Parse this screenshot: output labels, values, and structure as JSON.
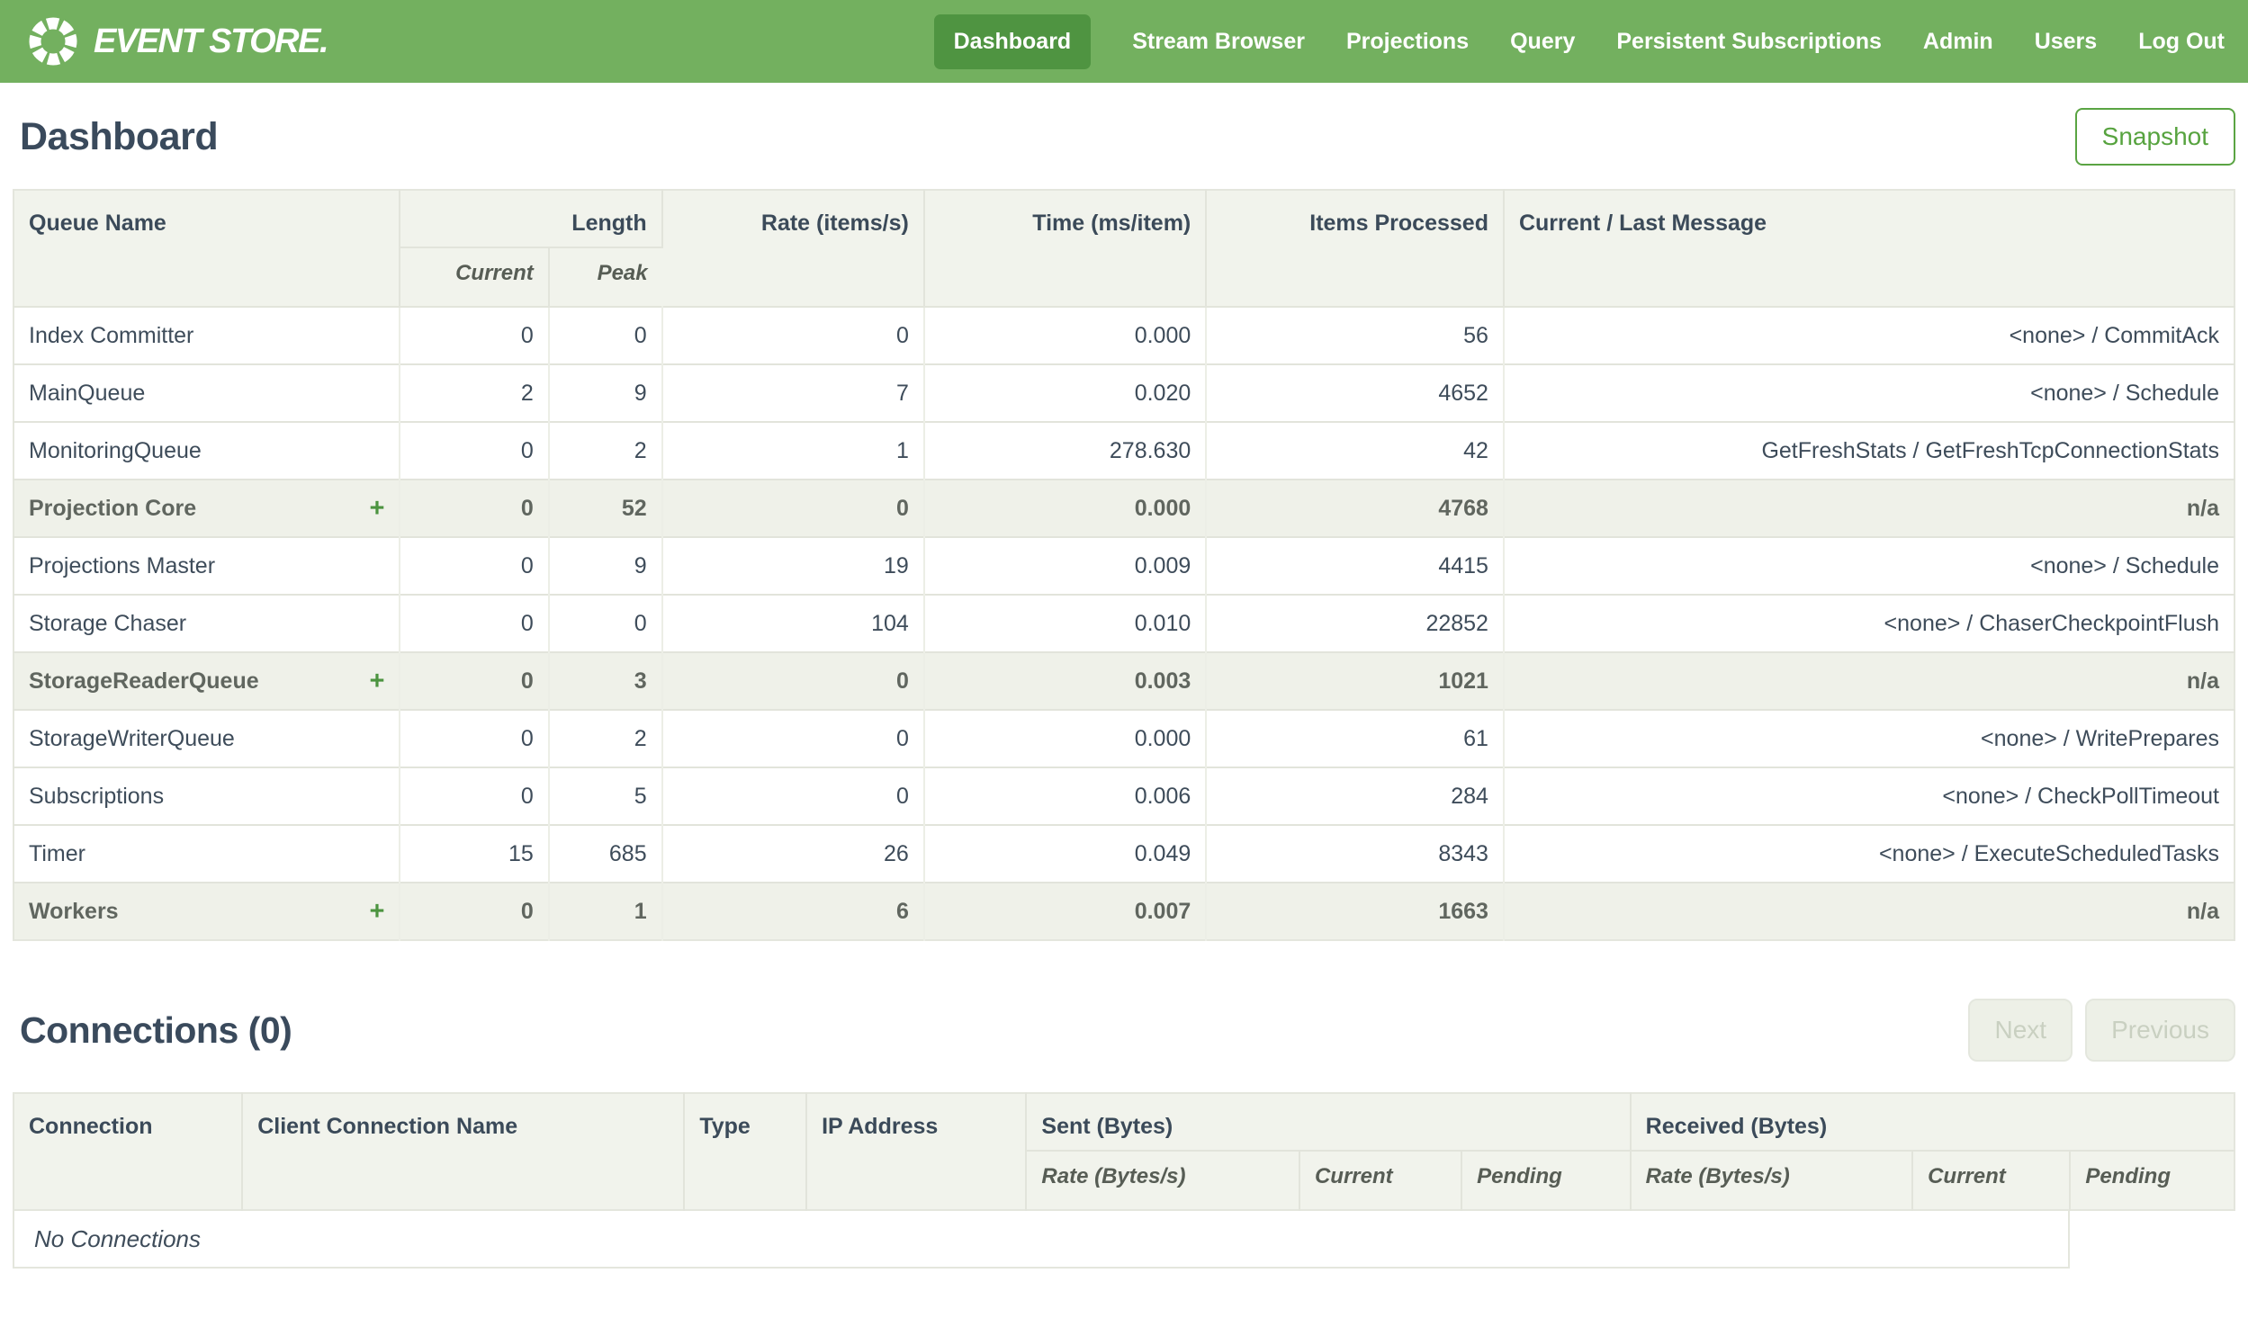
{
  "header": {
    "logo_text": "EVENT STORE.",
    "logo_icon": "segmented-ring-icon",
    "nav": [
      {
        "label": "Dashboard",
        "active": true
      },
      {
        "label": "Stream Browser"
      },
      {
        "label": "Projections"
      },
      {
        "label": "Query"
      },
      {
        "label": "Persistent Subscriptions"
      },
      {
        "label": "Admin"
      },
      {
        "label": "Users"
      },
      {
        "label": "Log Out"
      }
    ]
  },
  "page": {
    "title": "Dashboard",
    "snapshot_button": "Snapshot"
  },
  "queues_table": {
    "headers": {
      "queue_name": "Queue Name",
      "length": "Length",
      "current": "Current",
      "peak": "Peak",
      "rate": "Rate (items/s)",
      "time": "Time (ms/item)",
      "items_processed": "Items Processed",
      "message": "Current / Last Message"
    },
    "expand_glyph": "+",
    "rows": [
      {
        "name": "Index Committer",
        "current": "0",
        "peak": "0",
        "rate": "0",
        "time": "0.000",
        "items": "56",
        "message": "<none> / CommitAck",
        "group": false
      },
      {
        "name": "MainQueue",
        "current": "2",
        "peak": "9",
        "rate": "7",
        "time": "0.020",
        "items": "4652",
        "message": "<none> / Schedule",
        "group": false
      },
      {
        "name": "MonitoringQueue",
        "current": "0",
        "peak": "2",
        "rate": "1",
        "time": "278.630",
        "items": "42",
        "message": "GetFreshStats / GetFreshTcpConnectionStats",
        "group": false
      },
      {
        "name": "Projection Core",
        "current": "0",
        "peak": "52",
        "rate": "0",
        "time": "0.000",
        "items": "4768",
        "message": "n/a",
        "group": true
      },
      {
        "name": "Projections Master",
        "current": "0",
        "peak": "9",
        "rate": "19",
        "time": "0.009",
        "items": "4415",
        "message": "<none> / Schedule",
        "group": false
      },
      {
        "name": "Storage Chaser",
        "current": "0",
        "peak": "0",
        "rate": "104",
        "time": "0.010",
        "items": "22852",
        "message": "<none> / ChaserCheckpointFlush",
        "group": false
      },
      {
        "name": "StorageReaderQueue",
        "current": "0",
        "peak": "3",
        "rate": "0",
        "time": "0.003",
        "items": "1021",
        "message": "n/a",
        "group": true
      },
      {
        "name": "StorageWriterQueue",
        "current": "0",
        "peak": "2",
        "rate": "0",
        "time": "0.000",
        "items": "61",
        "message": "<none> / WritePrepares",
        "group": false
      },
      {
        "name": "Subscriptions",
        "current": "0",
        "peak": "5",
        "rate": "0",
        "time": "0.006",
        "items": "284",
        "message": "<none> / CheckPollTimeout",
        "group": false
      },
      {
        "name": "Timer",
        "current": "15",
        "peak": "685",
        "rate": "26",
        "time": "0.049",
        "items": "8343",
        "message": "<none> / ExecuteScheduledTasks",
        "group": false
      },
      {
        "name": "Workers",
        "current": "0",
        "peak": "1",
        "rate": "6",
        "time": "0.007",
        "items": "1663",
        "message": "n/a",
        "group": true
      }
    ]
  },
  "connections": {
    "title": "Connections (0)",
    "buttons": {
      "next": "Next",
      "previous": "Previous"
    },
    "headers": {
      "connection": "Connection",
      "client_name": "Client Connection Name",
      "type": "Type",
      "ip": "IP Address",
      "sent": "Sent (Bytes)",
      "received": "Received (Bytes)",
      "rate": "Rate (Bytes/s)",
      "current": "Current",
      "pending": "Pending"
    },
    "empty_message": "No Connections"
  },
  "colors": {
    "header_green": "#73b05f",
    "active_nav_green": "#4f9441",
    "accent_green": "#57a33f",
    "heading_text": "#3a4a5c",
    "table_header_bg": "#f1f3ec",
    "group_row_bg": "#eff1e9"
  }
}
